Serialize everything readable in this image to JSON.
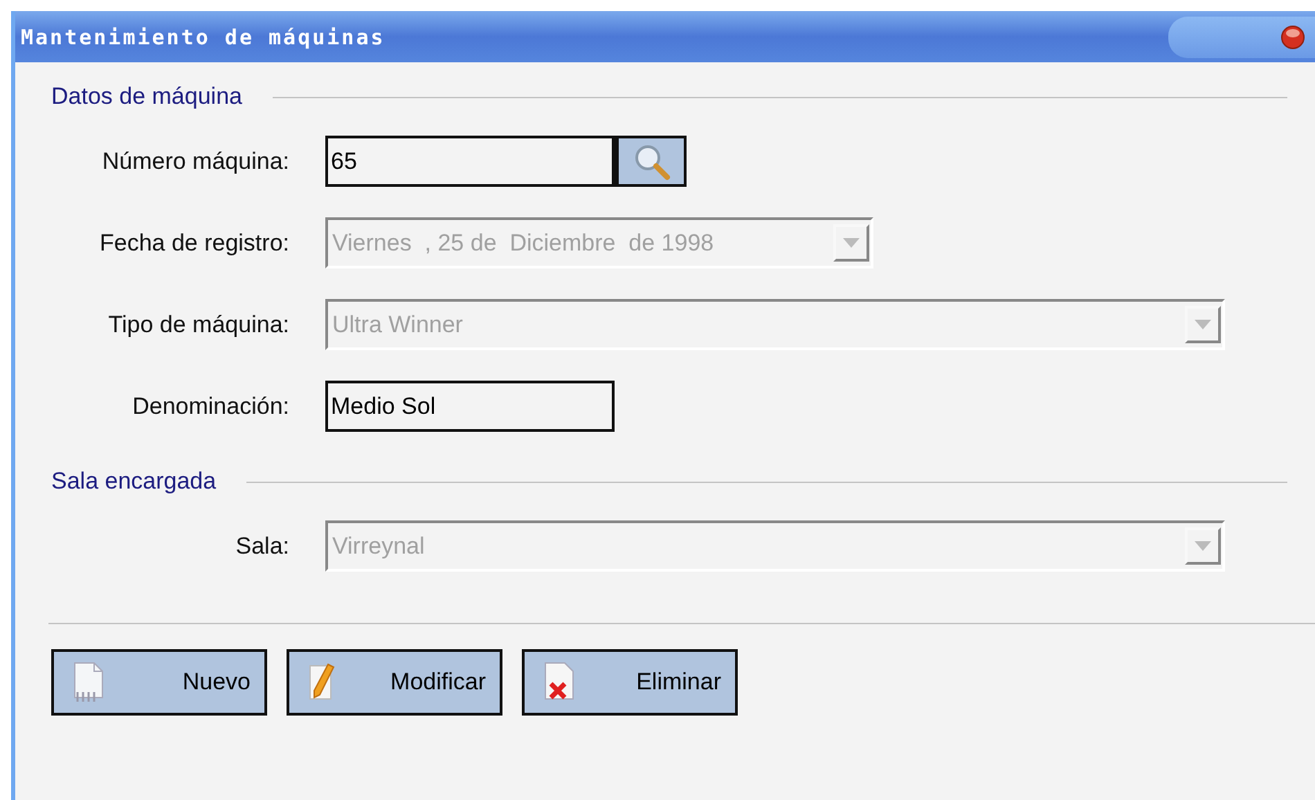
{
  "window": {
    "title": "Mantenimiento de máquinas"
  },
  "sections": [
    {
      "title": "Datos de máquina",
      "fields": [
        {
          "label": "Número máquina:",
          "kind": "text",
          "value": "65",
          "disabled": false,
          "lookup": true
        },
        {
          "label": "Fecha de registro:",
          "kind": "date",
          "value": "Viernes  , 25 de  Diciembre  de 1998",
          "disabled": true,
          "lookup": false
        },
        {
          "label": "Tipo de máquina:",
          "kind": "combo",
          "value": "Ultra Winner",
          "disabled": true,
          "lookup": false
        },
        {
          "label": "Denominación:",
          "kind": "text",
          "value": "Medio Sol",
          "disabled": false,
          "lookup": false
        }
      ]
    },
    {
      "title": "Sala encargada",
      "fields": [
        {
          "label": "Sala:",
          "kind": "combo",
          "value": "Virreynal",
          "disabled": true,
          "lookup": false
        }
      ]
    }
  ],
  "buttons": [
    {
      "label": "Nuevo",
      "kind": "new"
    },
    {
      "label": "Modificar",
      "kind": "edit"
    },
    {
      "label": "Eliminar",
      "kind": "delete"
    }
  ]
}
